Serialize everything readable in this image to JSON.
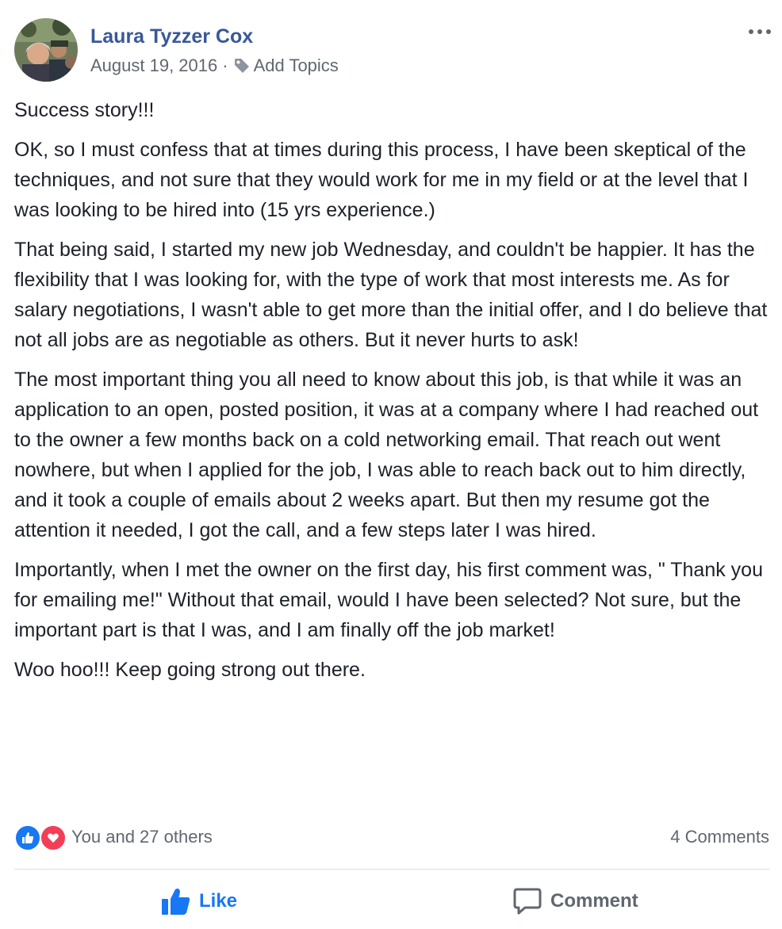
{
  "post": {
    "author": "Laura Tyzzer Cox",
    "date": "August 19, 2016",
    "separator": "·",
    "add_topics": "Add Topics",
    "paragraphs": [
      "Success story!!!",
      "OK, so I must confess that at times during this process, I have been skeptical of the techniques, and not sure that they would work for me in my field or at the level that I was looking to be hired into (15 yrs experience.)",
      "That being said, I started my new job Wednesday, and couldn't be happier. It has the flexibility that I was looking for, with the type of work that most interests me. As for salary negotiations, I wasn't able to get more than the initial offer, and I do believe that not all jobs are as negotiable as others. But it never hurts to ask!",
      "The most important thing you all need to know about this job, is that while it was an application to an open, posted position, it was at a company where I had reached out to the owner a few months back on a cold networking email. That reach out went nowhere, but when I applied for the job, I was able to reach back out to him directly, and it took a couple of emails about 2 weeks apart. But then my resume got the attention it needed, I got the call, and a few steps later I was hired.",
      "Importantly, when I met the owner on the first day, his first comment was, \" Thank you for emailing me!\" Without that email, would I have been selected? Not sure, but the important part is that I was, and I am finally off the job market!",
      "Woo hoo!!! Keep going strong out there."
    ]
  },
  "reactions": {
    "summary": "You and 27 others",
    "comments": "4 Comments",
    "icons": [
      "like-icon",
      "love-icon"
    ]
  },
  "actions": {
    "like_label": "Like",
    "comment_label": "Comment"
  },
  "icons": {
    "tag": "tag-icon",
    "more": "more-options-icon",
    "like": "thumbs-up-icon",
    "comment": "comment-bubble-icon"
  },
  "colors": {
    "author_link": "#385898",
    "meta_text": "#616770",
    "like_blue": "#1877f2",
    "love_red": "#f33e58",
    "divider": "#dadde1"
  }
}
